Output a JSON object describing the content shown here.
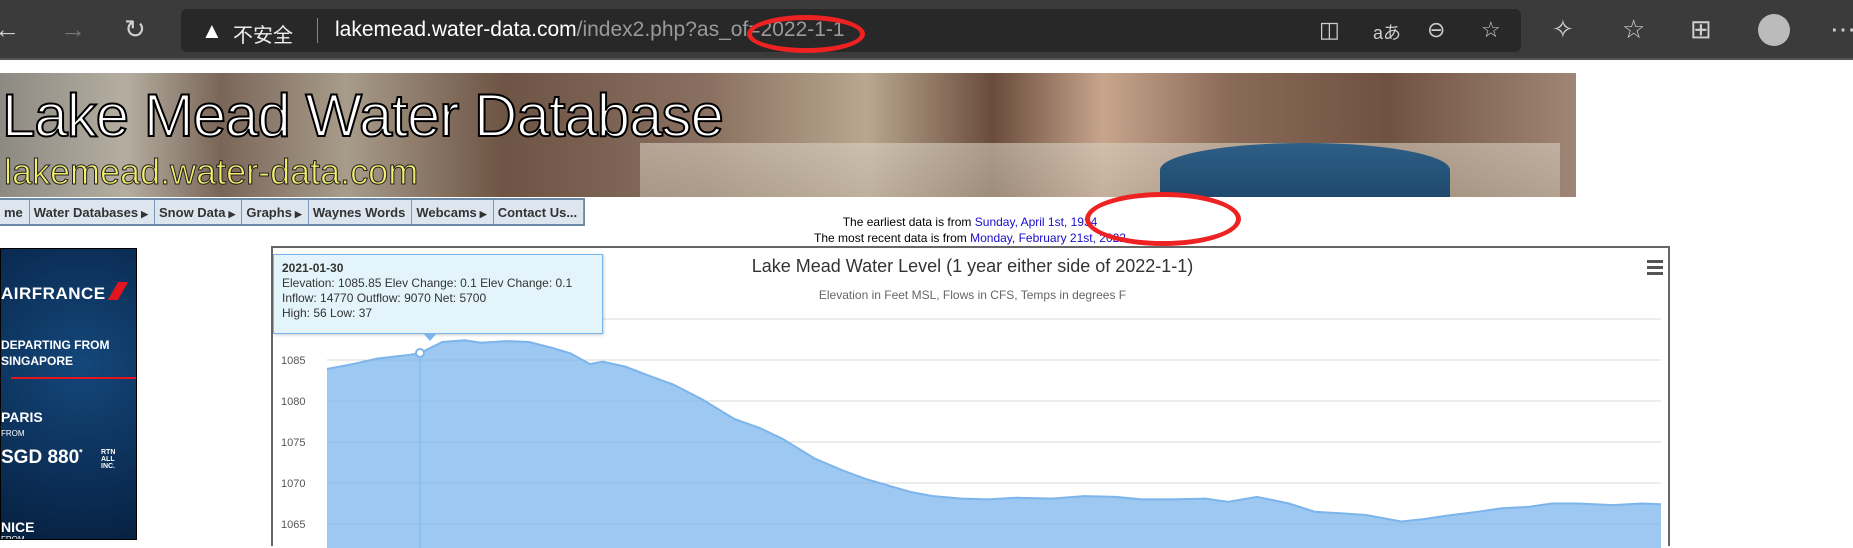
{
  "browser": {
    "security_label": "不安全",
    "url_host": "lakemead.water-data.com",
    "url_path": "/index2.php?as_of=2022-1-1",
    "icons": [
      "back-icon",
      "forward-icon",
      "refresh-icon",
      "warning-icon",
      "immersive-reader-icon",
      "translate-icon",
      "zoom-out-icon",
      "add-favorite-icon",
      "extensions-icon",
      "favorites-icon",
      "collections-icon",
      "profile-icon",
      "more-icon"
    ]
  },
  "banner": {
    "title": "Lake Mead Water Database",
    "subtitle": "lakemead.water-data.com"
  },
  "menu": [
    {
      "label": "me",
      "arrow": false
    },
    {
      "label": "Water Databases",
      "arrow": true
    },
    {
      "label": "Snow Data",
      "arrow": true
    },
    {
      "label": "Graphs",
      "arrow": true
    },
    {
      "label": "Waynes Words",
      "arrow": false
    },
    {
      "label": "Webcams",
      "arrow": true
    },
    {
      "label": "Contact Us...",
      "arrow": false
    }
  ],
  "info": {
    "earliest_prefix": "The earliest data is from ",
    "earliest_date": "Sunday, April 1st, 1934",
    "recent_prefix": "The most recent data is from ",
    "recent_date": "Monday, February 21st, 2022"
  },
  "ad": {
    "brand": "AIRFRANCE",
    "departing": "DEPARTING FROM",
    "origin": "SINGAPORE",
    "city1": "PARIS",
    "from": "FROM",
    "price1": "SGD 880",
    "price_mark": "*",
    "rtn": [
      "RTN",
      "ALL",
      "INC."
    ],
    "city2": "NICE",
    "brand_color": "#e4151f"
  },
  "tooltip": {
    "date": "2021-01-30",
    "line1": "Elevation: 1085.85 Elev Change: 0.1 Elev Change: 0.1",
    "line2": "Inflow: 14770 Outflow: 9070 Net: 5700",
    "line3": "High: 56 Low: 37"
  },
  "chart_data": {
    "type": "area",
    "title": "Lake Mead Water Level (1 year either side of 2022-1-1)",
    "subtitle": "Elevation in Feet MSL, Flows in CFS, Temps in degrees F",
    "ylim": [
      1062,
      1092
    ],
    "yticks": [
      1065,
      1070,
      1075,
      1080,
      1085,
      1090
    ],
    "ytick_labels": [
      "1065",
      "1070",
      "1075",
      "1080",
      "1085",
      ""
    ],
    "grid": true,
    "color": "#7cb5ec",
    "highlight": {
      "x": "2021-01-30",
      "y": 1085.85
    },
    "x": [
      "2021-01-01",
      "2021-01-09",
      "2021-01-17",
      "2021-01-27",
      "2021-01-30",
      "2021-02-06",
      "2021-02-13",
      "2021-02-18",
      "2021-02-26",
      "2021-03-05",
      "2021-03-12",
      "2021-03-18",
      "2021-03-24",
      "2021-03-28",
      "2021-04-04",
      "2021-04-12",
      "2021-04-19",
      "2021-04-28",
      "2021-05-08",
      "2021-05-16",
      "2021-05-23",
      "2021-06-02",
      "2021-06-11",
      "2021-06-18",
      "2021-06-25",
      "2021-07-02",
      "2021-07-09",
      "2021-07-18",
      "2021-07-26",
      "2021-08-04",
      "2021-08-15",
      "2021-08-25",
      "2021-09-04",
      "2021-09-12",
      "2021-09-21",
      "2021-10-02",
      "2021-10-09",
      "2021-10-18",
      "2021-10-28",
      "2021-11-05",
      "2021-11-13",
      "2021-11-21",
      "2021-12-02",
      "2021-12-09",
      "2021-12-16",
      "2021-12-26",
      "2022-01-02",
      "2022-01-11",
      "2022-01-18",
      "2022-01-26",
      "2022-02-06",
      "2022-02-15",
      "2022-02-21"
    ],
    "values": [
      1083.9,
      1084.5,
      1085.2,
      1085.65,
      1085.85,
      1087.2,
      1087.4,
      1087.1,
      1087.3,
      1087.2,
      1086.5,
      1085.8,
      1084.5,
      1084.8,
      1084.2,
      1083.0,
      1082.0,
      1080.2,
      1077.8,
      1076.7,
      1075.4,
      1073.0,
      1071.5,
      1070.5,
      1069.7,
      1068.9,
      1068.4,
      1068.1,
      1068.0,
      1068.2,
      1068.1,
      1068.4,
      1068.3,
      1068.0,
      1068.0,
      1068.1,
      1067.7,
      1068.3,
      1067.5,
      1066.5,
      1066.3,
      1066.1,
      1065.3,
      1065.6,
      1066.0,
      1066.5,
      1066.9,
      1067.1,
      1067.5,
      1067.5,
      1067.3,
      1067.5,
      1067.4
    ]
  }
}
